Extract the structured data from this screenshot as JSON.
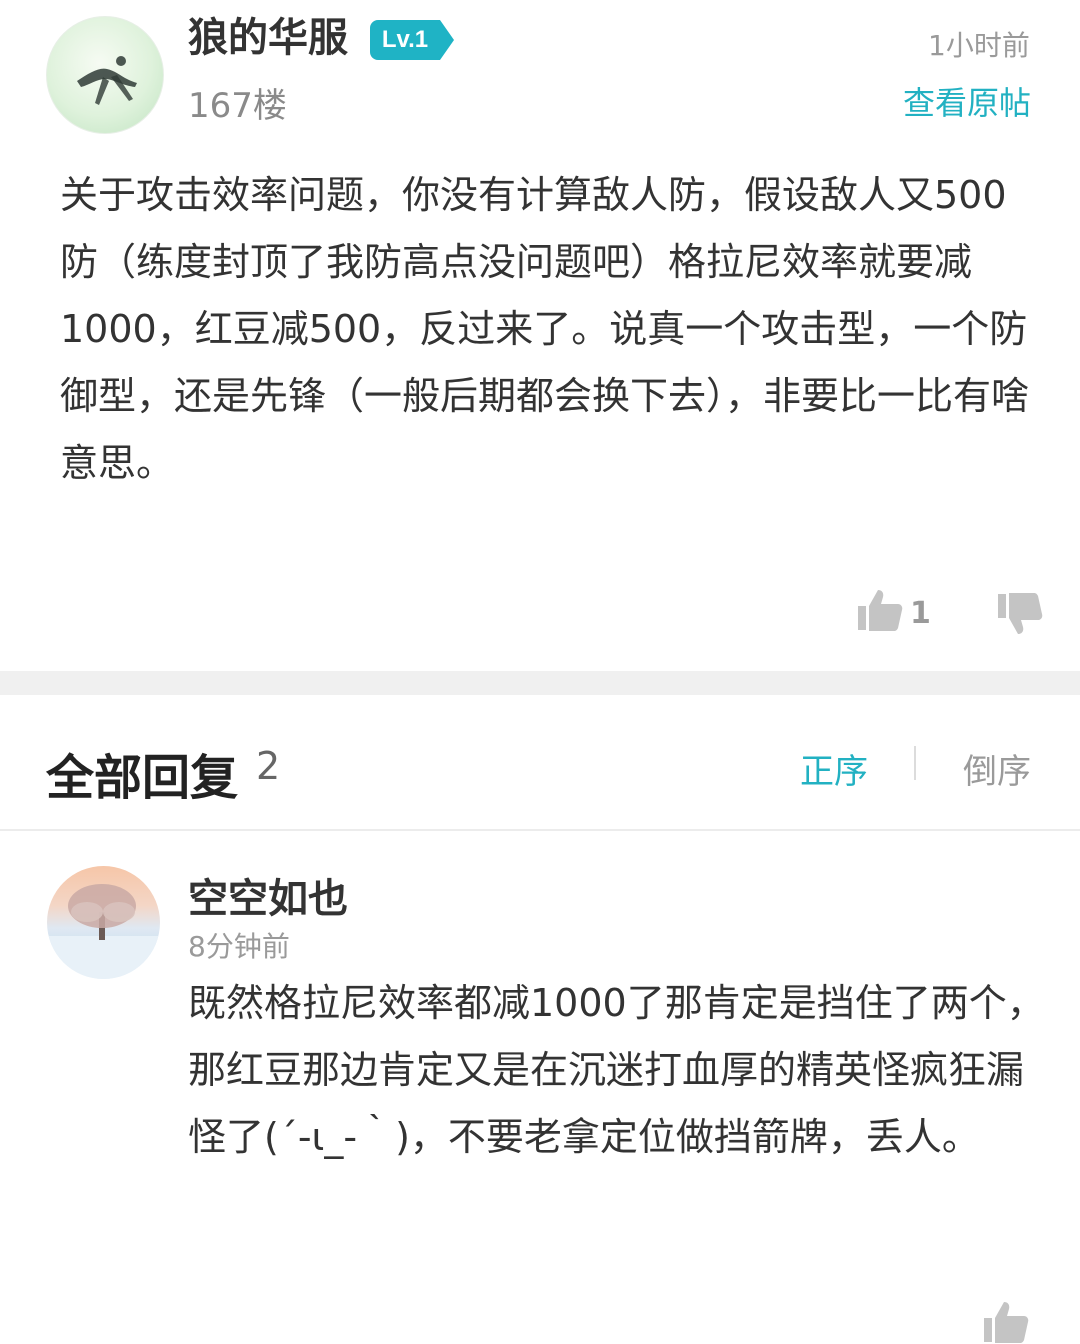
{
  "post": {
    "username": "狼的华服",
    "level": "Lv.1",
    "floor": "167楼",
    "time": "1小时前",
    "view_original": "查看原帖",
    "body": "关于攻击效率问题，你没有计算敌人防，假设敌人又500防（练度封顶了我防高点没问题吧）格拉尼效率就要减1000，红豆减500，反过来了。说真一个攻击型，一个防御型，还是先锋（一般后期都会换下去），非要比一比有啥意思。",
    "likes": "1"
  },
  "replies_header": {
    "title": "全部回复",
    "count": "2",
    "sort_asc": "正序",
    "sort_desc": "倒序"
  },
  "reply": {
    "username": "空空如也",
    "time": "8分钟前",
    "body": "既然格拉尼效率都减1000了那肯定是挡住了两个，那红豆那边肯定又是在沉迷打血厚的精英怪疯狂漏怪了(´-ι_-｀)，不要老拿定位做挡箭牌，丢人。"
  },
  "colors": {
    "accent": "#22b1c2",
    "badge": "#1fb3c5",
    "muted": "#9a9a9a",
    "icon": "#c4c4c4"
  },
  "icons": [
    "thumbs-up-icon",
    "thumbs-down-icon"
  ]
}
